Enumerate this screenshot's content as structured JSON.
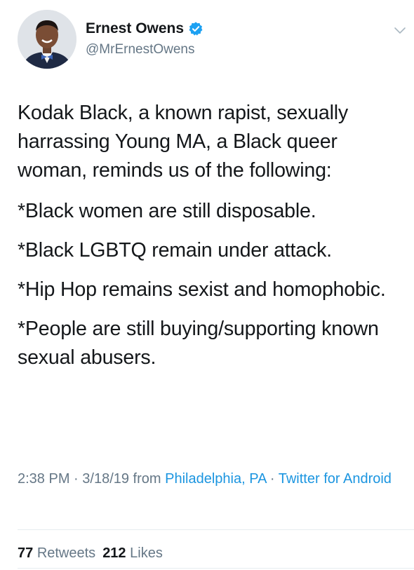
{
  "author": {
    "display_name": "Ernest Owens",
    "handle": "@MrErnestOwens",
    "verified": true,
    "avatar_icon": "profile-photo"
  },
  "tweet": {
    "paragraphs": [
      "Kodak Black, a known rapist, sexually harrassing Young MA, a Black queer woman, reminds us of the following:",
      "*Black women are still disposable.",
      "*Black LGBTQ remain under attack.",
      "*Hip Hop remains sexist and homophobic.",
      "*People are still buying/supporting known sexual abusers."
    ]
  },
  "meta": {
    "time": "2:38 PM",
    "separator1": " · ",
    "date": "3/18/19",
    "from_text": " from ",
    "location": "Philadelphia, PA",
    "separator2": " · ",
    "source": "Twitter for Android"
  },
  "stats": {
    "retweets_count": "77",
    "retweets_label": "Retweets",
    "likes_count": "212",
    "likes_label": "Likes"
  },
  "colors": {
    "link": "#1b95e0",
    "secondary_text": "#657786",
    "primary_text": "#14171a",
    "verified_badge": "#1da1f2"
  }
}
